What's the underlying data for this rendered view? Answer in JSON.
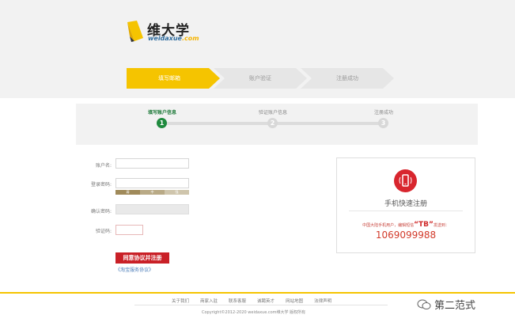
{
  "logo": {
    "title": "维大学",
    "sub_prefix": "weidaxue",
    "sub_suffix": ".com"
  },
  "steps": [
    {
      "label": "填写邮箱",
      "state": "active"
    },
    {
      "label": "账户验证",
      "state": "inactive"
    },
    {
      "label": "注册成功",
      "state": "inactive"
    }
  ],
  "progress": [
    {
      "label": "填写账户信息",
      "num": "1",
      "state": "active"
    },
    {
      "label": "验证账户信息",
      "num": "2",
      "state": "inactive"
    },
    {
      "label": "注册成功",
      "num": "3",
      "state": "inactive"
    }
  ],
  "form": {
    "account_label": "账户名:",
    "password_label": "登录密码:",
    "strength": [
      "弱",
      "中",
      "强"
    ],
    "confirm_label": "确认密码:",
    "captcha_label": "验证码:",
    "submit_label": "同意协议并注册",
    "terms_label": "《淘宝服务协议》"
  },
  "mobile": {
    "title": "手机快速注册",
    "desc_prefix": "中国大陆手机用户，编辑短信",
    "desc_code": "“TB”",
    "desc_suffix": "发送到：",
    "number": "1069099988"
  },
  "footer": {
    "links": [
      "关于我们",
      "商家入驻",
      "联系客服",
      "诚聘英才",
      "网站地图",
      "法律声明"
    ],
    "copyright": "Copyright©2012-2020  weidaxue.com维大学 版权所有"
  },
  "watermark": {
    "text": "第二范式"
  },
  "colors": {
    "accent": "#f5c400",
    "active_green": "#1f8a3e",
    "submit_red": "#c92027"
  }
}
